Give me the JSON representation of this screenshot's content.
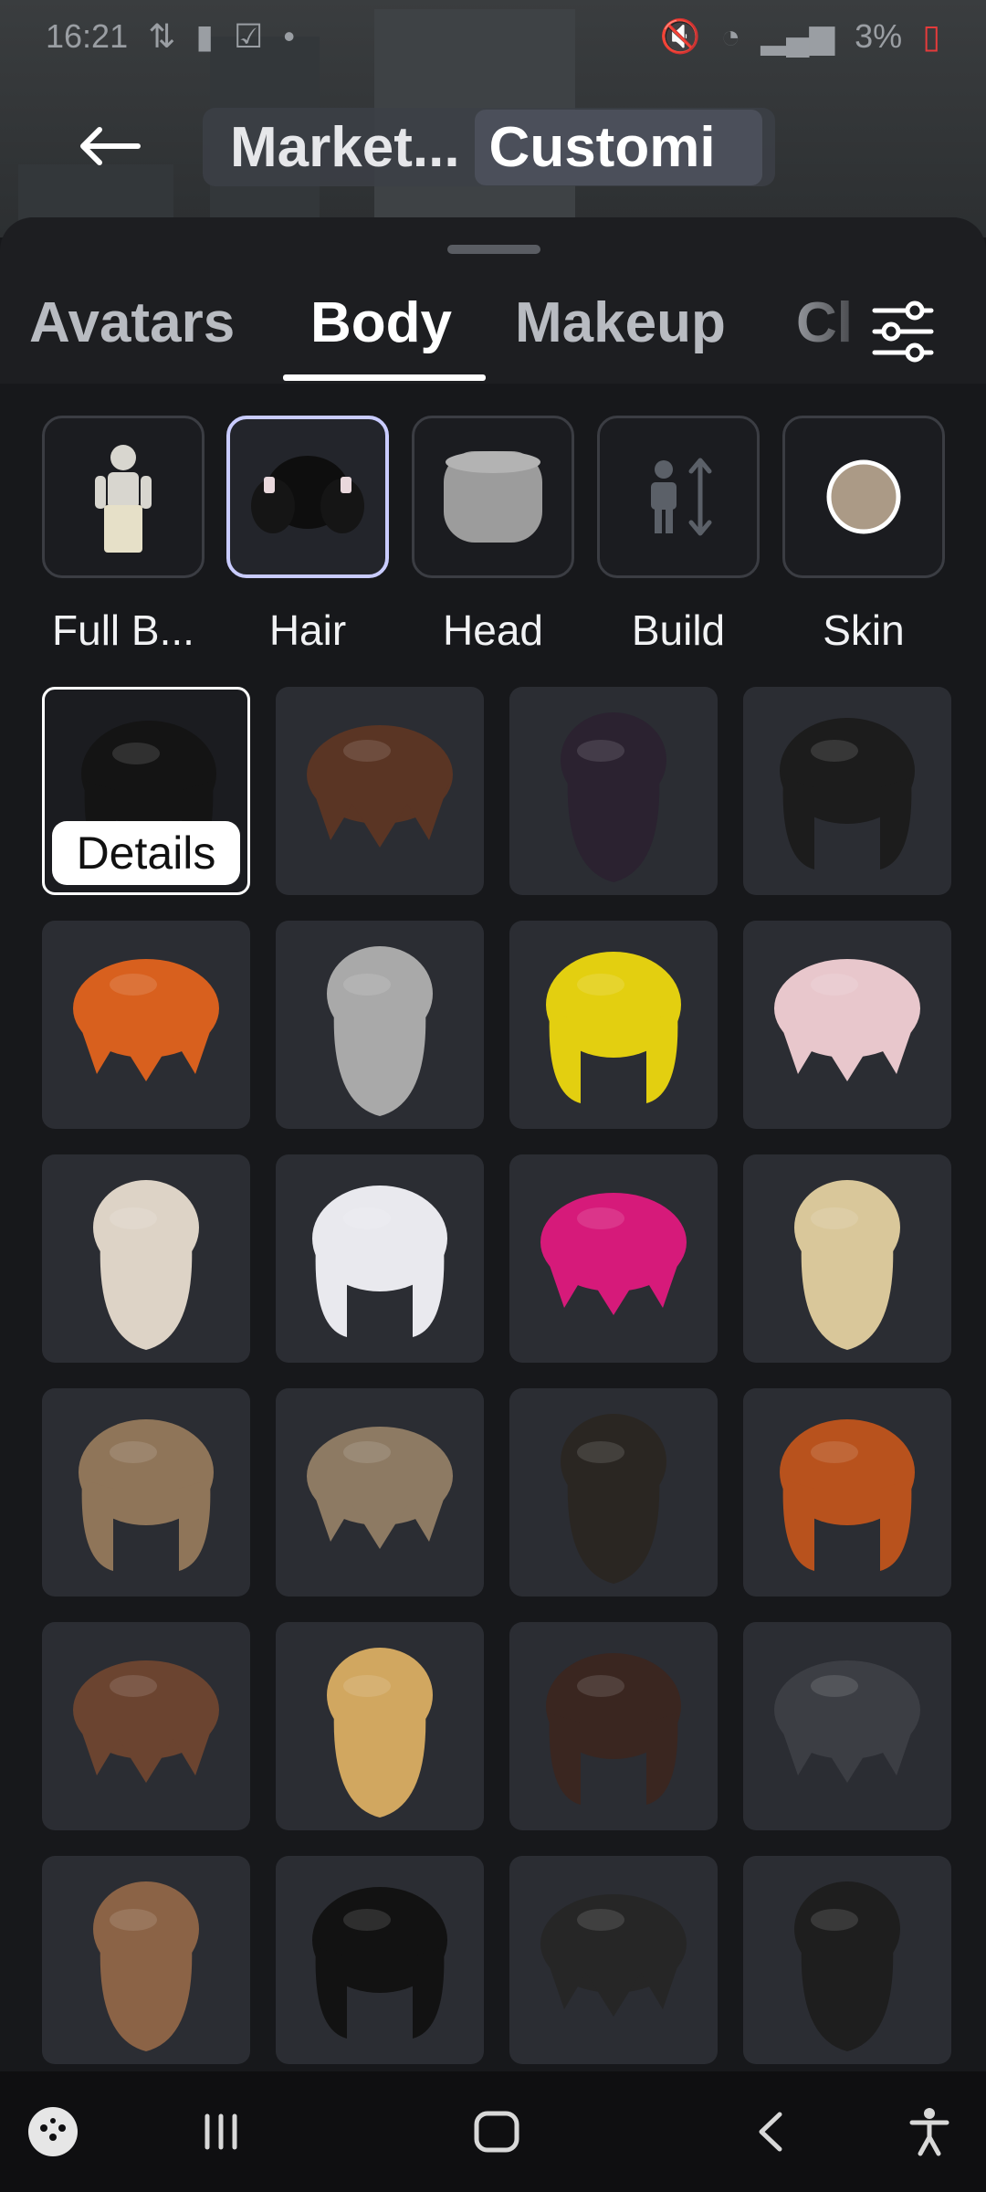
{
  "status_bar": {
    "time": "16:21",
    "battery_percent": "3%"
  },
  "header": {
    "breadcrumb": [
      "Market...",
      "Customi"
    ]
  },
  "tabs": [
    {
      "label": "Avatars",
      "active": false
    },
    {
      "label": "Body",
      "active": true
    },
    {
      "label": "Makeup",
      "active": false
    },
    {
      "label": "Cl",
      "active": false
    }
  ],
  "categories": [
    {
      "label": "Full B...",
      "icon": "full-body-icon",
      "selected": false
    },
    {
      "label": "Hair",
      "icon": "hair-icon",
      "selected": true
    },
    {
      "label": "Head",
      "icon": "head-icon",
      "selected": false
    },
    {
      "label": "Build",
      "icon": "build-icon",
      "selected": false
    },
    {
      "label": "Skin",
      "icon": "skin-tone-icon",
      "selected": false
    }
  ],
  "selected_item": {
    "details_label": "Details"
  },
  "hair_colors": [
    "#141414",
    "#5a3524",
    "#2b2230",
    "#1c1c1c",
    "#d8601e",
    "#a9a9a9",
    "#e3cf10",
    "#e8c7cc",
    "#ddd3c6",
    "#e9e9ee",
    "#d61a7a",
    "#d9c79a",
    "#8f7559",
    "#8d7a63",
    "#2a2622",
    "#b8521d",
    "#6b4430",
    "#d1a760",
    "#3a2620",
    "#3c3e44",
    "#8b6346",
    "#121212",
    "#262626",
    "#1e1e1e"
  ],
  "colors": {
    "sheet": "#1d1e21",
    "tile": "#2b2d33",
    "accent_border": "#c9ccff"
  }
}
